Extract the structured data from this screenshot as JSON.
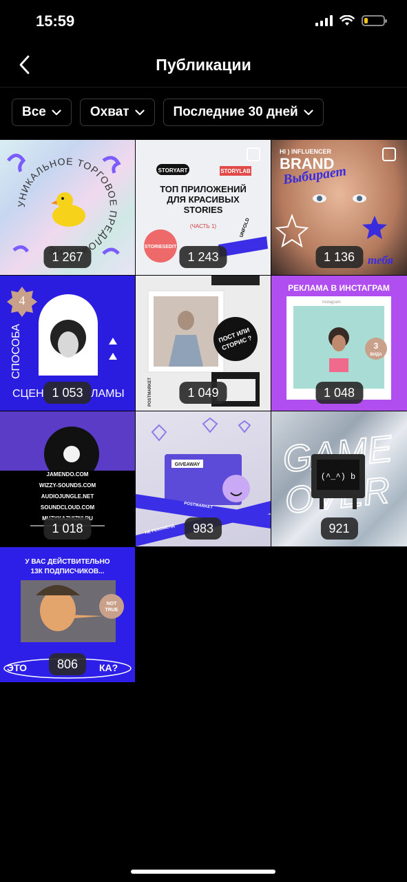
{
  "status_bar": {
    "time": "15:59",
    "battery_level": 0.2,
    "battery_color": "#f3c31d"
  },
  "header": {
    "title": "Публикации",
    "back_icon": "chevron-left-icon"
  },
  "filters": [
    {
      "label": "Все",
      "icon": "chevron-down-icon"
    },
    {
      "label": "Охват",
      "icon": "chevron-down-icon"
    },
    {
      "label": "Последние 30 дней",
      "icon": "chevron-down-icon"
    }
  ],
  "posts": [
    {
      "count": "1 267",
      "ring_text": "УНИКАЛЬНОЕ ТОРГОВОЕ ПРЕДЛОЖЕНИЕ"
    },
    {
      "count": "1 243",
      "headline": "ТОП ПРИЛОЖЕНИЙ ДЛЯ КРАСИВЫХ STORIES",
      "sub": "(ЧАСТЬ 1)",
      "tags": [
        "STORYART",
        "STORYLAB",
        "UNFOLD",
        "STORIESEDIT"
      ]
    },
    {
      "count": "1 136",
      "top": "HI ) INFLUENCER",
      "brand": "BRAND",
      "script1": "Выбирает",
      "script2": "тебя"
    },
    {
      "count": "1 053",
      "badge": "4",
      "side": "СПОСОБА",
      "bottom": "СЦЕН",
      "bottom_right": "ЛАМЫ"
    },
    {
      "count": "1 049",
      "bubble": "ПОСТ ИЛИ СТОРИС ?",
      "vertical": "POSTMARKET"
    },
    {
      "count": "1 048",
      "title": "РЕКЛАМА В ИНСТАГРАМ",
      "handle": "Instagram",
      "badge_num": "3",
      "badge_word": "ВИДА"
    },
    {
      "count": "1 018",
      "links": [
        "JAMENDO.COM",
        "WIZZY-SOUNDS.COM",
        "AUDIOJUNGLE.NET",
        "SOUNDCLOUD.COM",
        "MUZYKAZHIZNI.RU"
      ]
    },
    {
      "count": "983",
      "pack": "GIVEAWAY",
      "tape1": "POSTMARKET",
      "tape2": "НЕ РЕКОМЕНД"
    },
    {
      "count": "921",
      "line1": "GAME",
      "line2": "OVER",
      "tv_face": "(^_^) b"
    },
    {
      "count": "806",
      "title": "У ВАС ДЕЙСТВИТЕЛЬНО 13К ПОДПИСЧИКОВ...",
      "sticker": "NOT TRUE",
      "bottom_left": "ЭТО",
      "bottom_right": "КА?"
    }
  ]
}
